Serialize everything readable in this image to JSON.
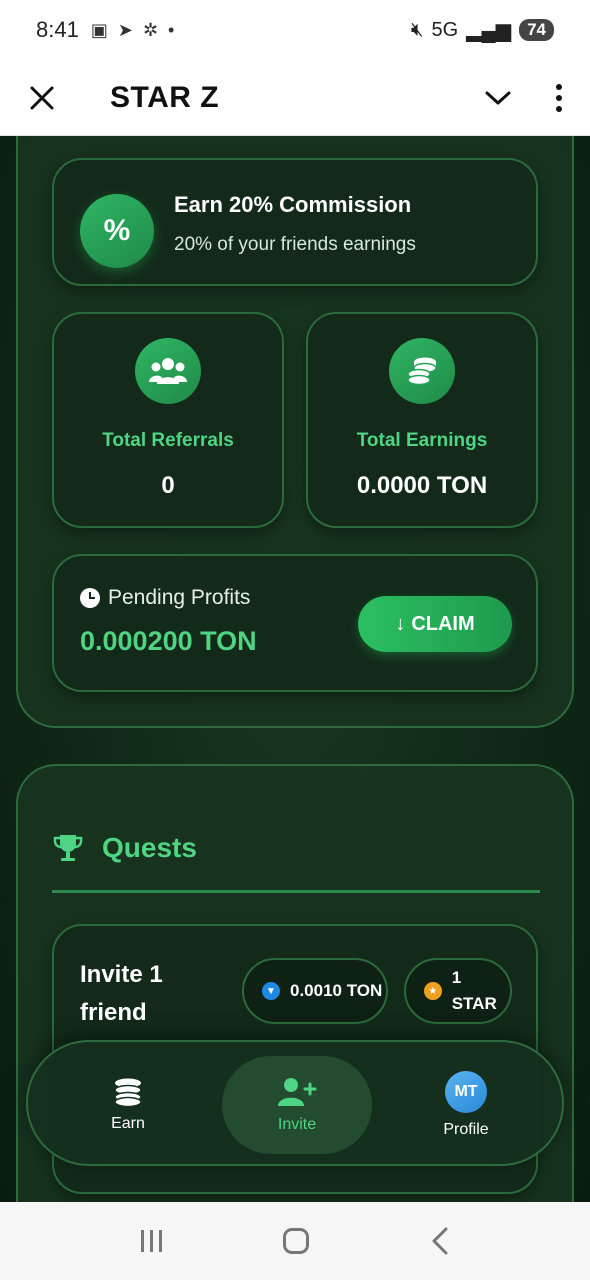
{
  "status_bar": {
    "time": "8:41",
    "network": "5G",
    "battery": "74"
  },
  "header": {
    "title": "STAR Z"
  },
  "commission": {
    "title": "Earn 20% Commission",
    "subtitle": "20% of your friends earnings",
    "badge": "%"
  },
  "stats": {
    "referrals_label": "Total Referrals",
    "referrals_value": "0",
    "earnings_label": "Total Earnings",
    "earnings_value": "0.0000 TON"
  },
  "pending": {
    "label": "Pending Profits",
    "amount": "0.000200 TON",
    "claim_label": "CLAIM",
    "claim_arrow": "↓"
  },
  "quests": {
    "title": "Quests",
    "items": [
      {
        "title": "Invite 1 friend",
        "reward_ton": "0.0010 TON",
        "reward_star": "1 STAR"
      }
    ]
  },
  "bottom_nav": {
    "earn": "Earn",
    "invite": "Invite",
    "profile": "Profile",
    "avatar_initials": "MT"
  },
  "colors": {
    "accent": "#4fd483",
    "button": "#2cbf62",
    "background": "#0f2616"
  }
}
